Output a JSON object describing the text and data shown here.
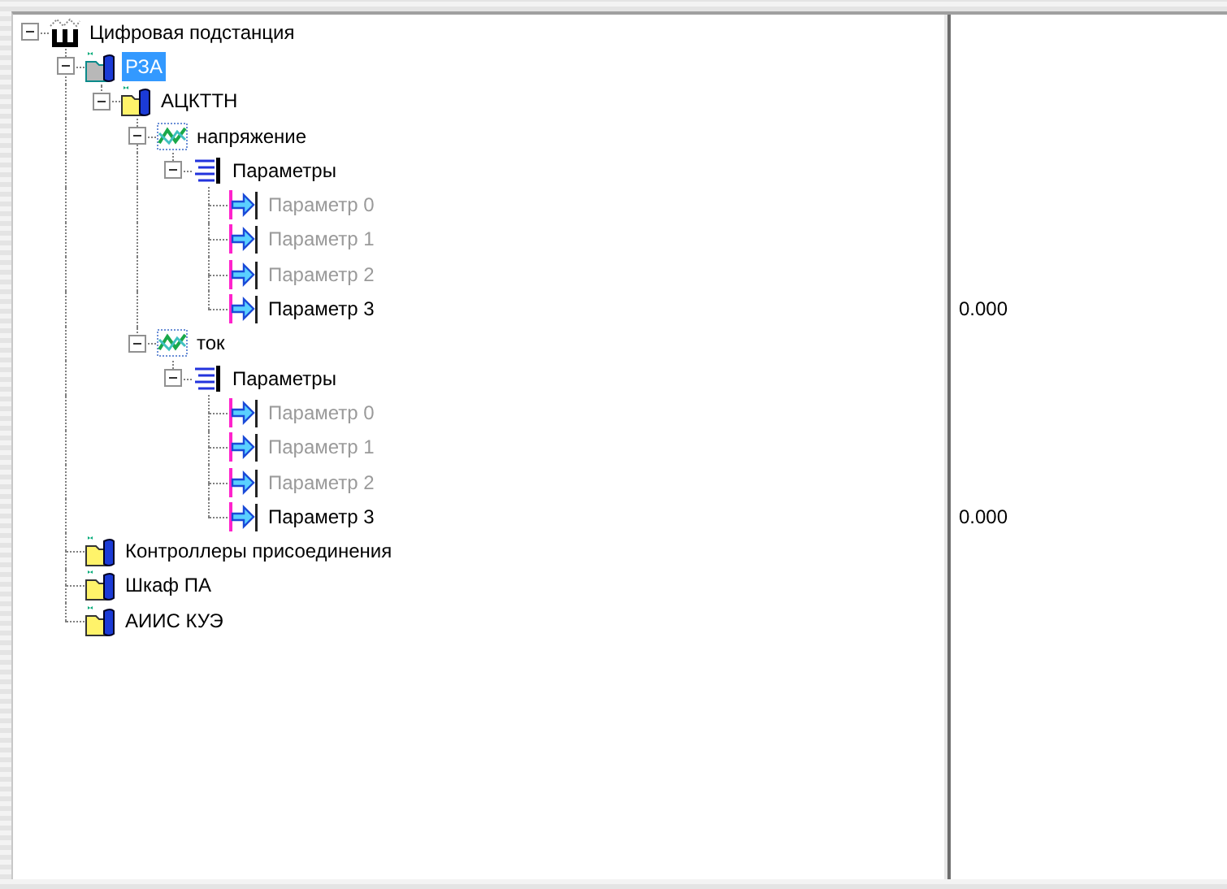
{
  "tree": [
    {
      "label": "Цифровая подстанция",
      "kind": "station",
      "expanded": true,
      "selected": false,
      "disabled": false,
      "children": [
        {
          "label": "РЗА",
          "kind": "device",
          "expanded": true,
          "selected": true,
          "disabled": false,
          "children": [
            {
              "label": "АЦКТТН",
              "kind": "folder",
              "expanded": true,
              "selected": false,
              "disabled": false,
              "children": [
                {
                  "label": "напряжение",
                  "kind": "signal",
                  "expanded": true,
                  "selected": false,
                  "disabled": false,
                  "children": [
                    {
                      "label": "Параметры",
                      "kind": "group",
                      "expanded": true,
                      "selected": false,
                      "disabled": false,
                      "children": [
                        {
                          "label": "Параметр 0",
                          "kind": "param",
                          "selected": false,
                          "disabled": true
                        },
                        {
                          "label": "Параметр 1",
                          "kind": "param",
                          "selected": false,
                          "disabled": true
                        },
                        {
                          "label": "Параметр 2",
                          "kind": "param",
                          "selected": false,
                          "disabled": true
                        },
                        {
                          "label": "Параметр 3",
                          "kind": "param",
                          "selected": false,
                          "disabled": false,
                          "value": "0.000"
                        }
                      ]
                    }
                  ]
                },
                {
                  "label": "ток",
                  "kind": "signal",
                  "expanded": true,
                  "selected": false,
                  "disabled": false,
                  "children": [
                    {
                      "label": "Параметры",
                      "kind": "group",
                      "expanded": true,
                      "selected": false,
                      "disabled": false,
                      "children": [
                        {
                          "label": "Параметр 0",
                          "kind": "param",
                          "selected": false,
                          "disabled": true
                        },
                        {
                          "label": "Параметр 1",
                          "kind": "param",
                          "selected": false,
                          "disabled": true
                        },
                        {
                          "label": "Параметр 2",
                          "kind": "param",
                          "selected": false,
                          "disabled": true
                        },
                        {
                          "label": "Параметр 3",
                          "kind": "param",
                          "selected": false,
                          "disabled": false,
                          "value": "0.000"
                        }
                      ]
                    }
                  ]
                }
              ]
            }
          ]
        },
        {
          "label": "Контроллеры присоединения",
          "kind": "folder",
          "selected": false,
          "disabled": false
        },
        {
          "label": "Шкаф ПА",
          "kind": "folder",
          "selected": false,
          "disabled": false
        },
        {
          "label": "АИИС КУЭ",
          "kind": "folder",
          "selected": false,
          "disabled": false
        }
      ]
    }
  ]
}
